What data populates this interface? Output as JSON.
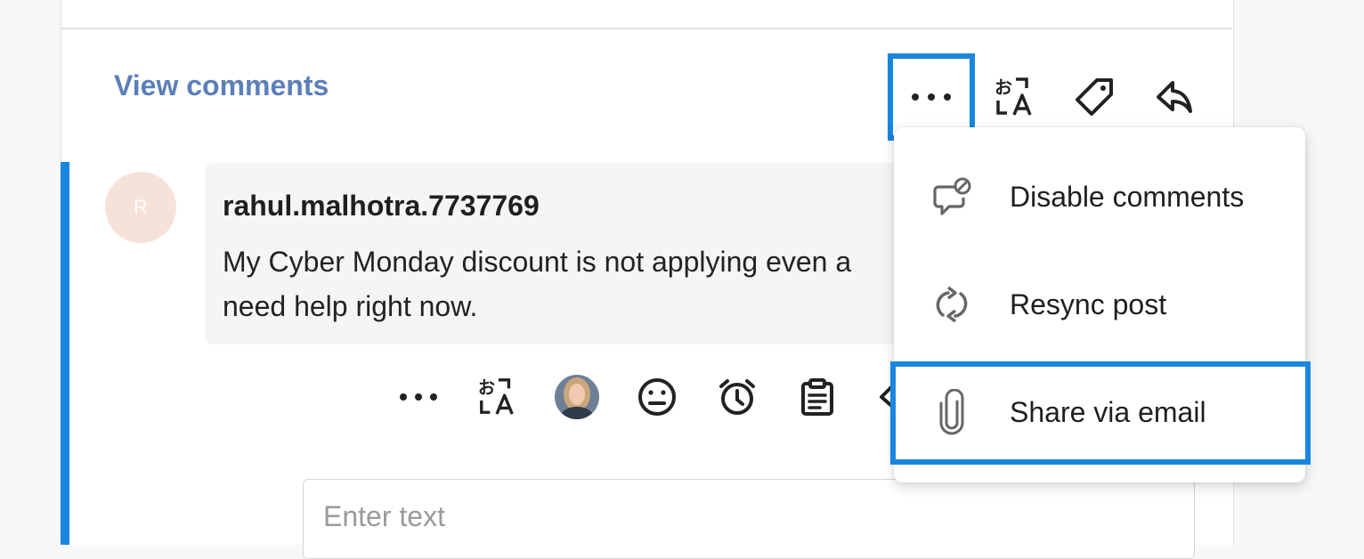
{
  "header": {
    "view_comments_label": "View comments",
    "actions": [
      {
        "name": "more-options-icon"
      },
      {
        "name": "translate-icon",
        "text_top": "お",
        "text_bottom": "A"
      },
      {
        "name": "tag-icon"
      },
      {
        "name": "reply-icon"
      }
    ]
  },
  "comment": {
    "avatar_initial": "R",
    "author": "rahul.malhotra.7737769",
    "text": "My Cyber Monday discount is not applying even a need help right now.",
    "actions": [
      {
        "name": "more-options-icon"
      },
      {
        "name": "translate-icon",
        "text_top": "お",
        "text_bottom": "A"
      },
      {
        "name": "assignee-avatar"
      },
      {
        "name": "emoji-icon"
      },
      {
        "name": "alarm-clock-icon"
      },
      {
        "name": "clipboard-icon"
      },
      {
        "name": "reply-icon"
      }
    ]
  },
  "reply": {
    "placeholder": "Enter text"
  },
  "menu": {
    "items": [
      {
        "label": "Disable comments",
        "icon": "disable-comments-icon"
      },
      {
        "label": "Resync post",
        "icon": "resync-icon"
      },
      {
        "label": "Share via email",
        "icon": "paperclip-icon"
      }
    ]
  },
  "colors": {
    "accent": "#1a86e0",
    "link": "#5b7fb8",
    "avatar_bg": "#f7e2da"
  }
}
